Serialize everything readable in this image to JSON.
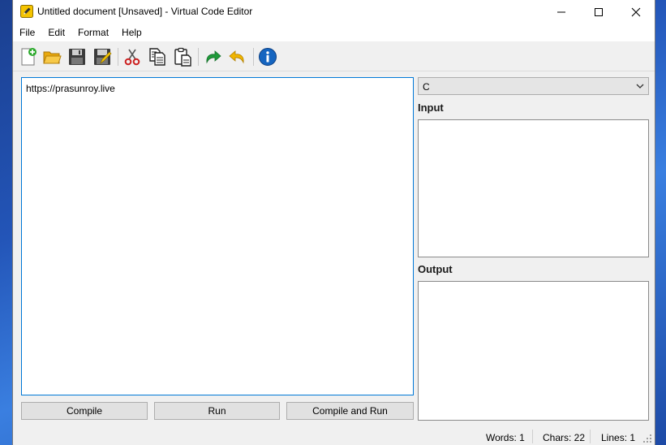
{
  "window": {
    "title": "Untitled document [Unsaved] - Virtual Code Editor"
  },
  "menu": {
    "items": [
      "File",
      "Edit",
      "Format",
      "Help"
    ]
  },
  "toolbar": {
    "icons": [
      "new-file-icon",
      "open-folder-icon",
      "save-icon",
      "save-as-icon",
      "cut-icon",
      "copy-icon",
      "paste-icon",
      "redo-icon",
      "undo-icon",
      "info-icon"
    ]
  },
  "editor": {
    "content": "https://prasunroy.live"
  },
  "buttons": {
    "compile": "Compile",
    "run": "Run",
    "compile_and_run": "Compile and Run"
  },
  "language": {
    "selected": "C"
  },
  "panels": {
    "input_label": "Input",
    "output_label": "Output",
    "input_value": "",
    "output_value": ""
  },
  "status": {
    "words": "Words: 1",
    "chars": "Chars: 22",
    "lines": "Lines: 1"
  },
  "colors": {
    "accent_focus": "#0078d7",
    "window_bg": "#f0f0f0",
    "desktop": "#2355b8"
  }
}
